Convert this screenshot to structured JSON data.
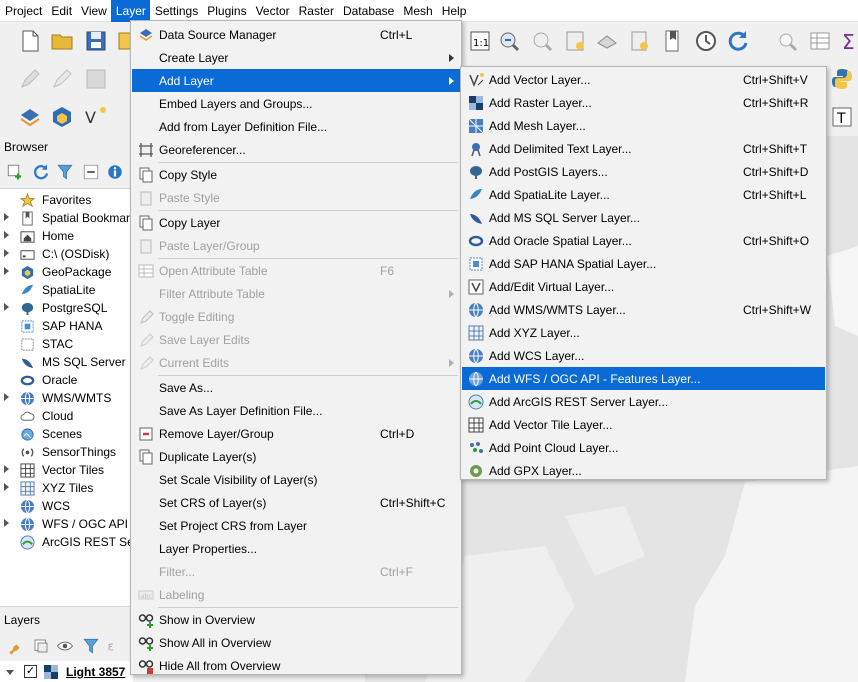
{
  "menubar": {
    "items": [
      "Project",
      "Edit",
      "View",
      "Layer",
      "Settings",
      "Plugins",
      "Vector",
      "Raster",
      "Database",
      "Mesh",
      "Help"
    ],
    "active": "Layer"
  },
  "browser": {
    "title": "Browser",
    "items": [
      {
        "label": "Favorites",
        "icon": "star-icon"
      },
      {
        "label": "Spatial Bookmarks",
        "icon": "bookmark-icon"
      },
      {
        "label": "Home",
        "icon": "home-folder-icon"
      },
      {
        "label": "C:\\ (OSDisk)",
        "icon": "drive-icon"
      },
      {
        "label": "GeoPackage",
        "icon": "geopackage-icon"
      },
      {
        "label": "SpatiaLite",
        "icon": "spatialite-icon"
      },
      {
        "label": "PostgreSQL",
        "icon": "postgresql-icon"
      },
      {
        "label": "SAP HANA",
        "icon": "sap-hana-icon"
      },
      {
        "label": "STAC",
        "icon": "stac-icon"
      },
      {
        "label": "MS SQL Server",
        "icon": "mssql-icon"
      },
      {
        "label": "Oracle",
        "icon": "oracle-icon"
      },
      {
        "label": "WMS/WMTS",
        "icon": "wms-icon"
      },
      {
        "label": "Cloud",
        "icon": "cloud-icon"
      },
      {
        "label": "Scenes",
        "icon": "scenes-icon"
      },
      {
        "label": "SensorThings",
        "icon": "sensorthings-icon"
      },
      {
        "label": "Vector Tiles",
        "icon": "vector-tiles-icon"
      },
      {
        "label": "XYZ Tiles",
        "icon": "xyz-tiles-icon"
      },
      {
        "label": "WCS",
        "icon": "wcs-icon"
      },
      {
        "label": "WFS / OGC API - Features",
        "icon": "wfs-icon"
      },
      {
        "label": "ArcGIS REST Servers",
        "icon": "arcgis-icon"
      }
    ]
  },
  "layers": {
    "title": "Layers",
    "layer_name": "Light 3857"
  },
  "layer_menu": {
    "items": [
      {
        "label": "Data Source Manager",
        "shortcut": "Ctrl+L"
      },
      {
        "label": "Create Layer"
      },
      {
        "label": "Add Layer"
      },
      {
        "label": "Embed Layers and Groups..."
      },
      {
        "label": "Add from Layer Definition File..."
      },
      {
        "label": "Georeferencer..."
      },
      {
        "label": "Copy Style"
      },
      {
        "label": "Paste Style"
      },
      {
        "label": "Copy Layer"
      },
      {
        "label": "Paste Layer/Group"
      },
      {
        "label": "Open Attribute Table",
        "shortcut": "F6"
      },
      {
        "label": "Filter Attribute Table"
      },
      {
        "label": "Toggle Editing"
      },
      {
        "label": "Save Layer Edits"
      },
      {
        "label": "Current Edits"
      },
      {
        "label": "Save As..."
      },
      {
        "label": "Save As Layer Definition File..."
      },
      {
        "label": "Remove Layer/Group",
        "shortcut": "Ctrl+D"
      },
      {
        "label": "Duplicate Layer(s)"
      },
      {
        "label": "Set Scale Visibility of Layer(s)"
      },
      {
        "label": "Set CRS of Layer(s)",
        "shortcut": "Ctrl+Shift+C"
      },
      {
        "label": "Set Project CRS from Layer"
      },
      {
        "label": "Layer Properties..."
      },
      {
        "label": "Filter...",
        "shortcut": "Ctrl+F"
      },
      {
        "label": "Labeling"
      },
      {
        "label": "Show in Overview"
      },
      {
        "label": "Show All in Overview"
      },
      {
        "label": "Hide All from Overview"
      }
    ]
  },
  "add_layer_menu": {
    "items": [
      {
        "label": "Add Vector Layer...",
        "shortcut": "Ctrl+Shift+V"
      },
      {
        "label": "Add Raster Layer...",
        "shortcut": "Ctrl+Shift+R"
      },
      {
        "label": "Add Mesh Layer..."
      },
      {
        "label": "Add Delimited Text Layer...",
        "shortcut": "Ctrl+Shift+T"
      },
      {
        "label": "Add PostGIS Layers...",
        "shortcut": "Ctrl+Shift+D"
      },
      {
        "label": "Add SpatiaLite Layer...",
        "shortcut": "Ctrl+Shift+L"
      },
      {
        "label": "Add MS SQL Server Layer..."
      },
      {
        "label": "Add Oracle Spatial Layer...",
        "shortcut": "Ctrl+Shift+O"
      },
      {
        "label": "Add SAP HANA Spatial Layer..."
      },
      {
        "label": "Add/Edit Virtual Layer..."
      },
      {
        "label": "Add WMS/WMTS Layer...",
        "shortcut": "Ctrl+Shift+W"
      },
      {
        "label": "Add XYZ Layer..."
      },
      {
        "label": "Add WCS Layer..."
      },
      {
        "label": "Add WFS / OGC API - Features Layer..."
      },
      {
        "label": "Add ArcGIS REST Server Layer..."
      },
      {
        "label": "Add Vector Tile Layer..."
      },
      {
        "label": "Add Point Cloud Layer..."
      },
      {
        "label": "Add GPX Layer..."
      }
    ]
  },
  "colors": {
    "highlight": "#0a6bd6",
    "disabled_text": "#a0a0a0",
    "menu_bg": "#f2f2f2"
  }
}
